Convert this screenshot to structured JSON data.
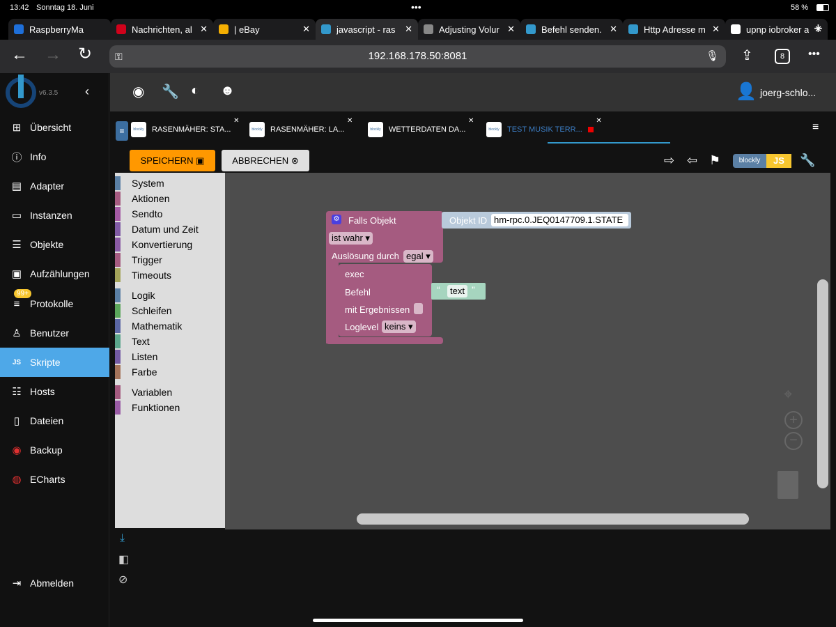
{
  "status": {
    "time": "13:42",
    "date": "Sonntag 18. Juni",
    "battery": "58 %"
  },
  "browser_tabs": [
    {
      "label": "RaspberryMa",
      "color": "#1e6fd9"
    },
    {
      "label": "Nachrichten, al",
      "color": "#d0021b"
    },
    {
      "label": "| eBay",
      "color": "#f5af02"
    },
    {
      "label": "javascript - ras",
      "color": "#3399cc"
    },
    {
      "label": "Adjusting Volur",
      "color": "#888"
    },
    {
      "label": "Befehl senden.",
      "color": "#3399cc"
    },
    {
      "label": "Http Adresse m",
      "color": "#3399cc"
    },
    {
      "label": "upnp iobroker a",
      "color": "#fff"
    }
  ],
  "url": "192.168.178.50:8081",
  "tab_count": "8",
  "app": {
    "version": "v6.3.5",
    "user": "joerg-schlo..."
  },
  "sidebar": [
    {
      "label": "Übersicht",
      "icon": "grid-icon"
    },
    {
      "label": "Info",
      "icon": "info-icon"
    },
    {
      "label": "Adapter",
      "icon": "store-icon"
    },
    {
      "label": "Instanzen",
      "icon": "instances-icon"
    },
    {
      "label": "Objekte",
      "icon": "list-icon"
    },
    {
      "label": "Aufzählungen",
      "icon": "enum-icon"
    },
    {
      "label": "Protokolle",
      "icon": "log-icon",
      "badge": "99+"
    },
    {
      "label": "Benutzer",
      "icon": "user-icon"
    },
    {
      "label": "Skripte",
      "icon": "js-icon"
    },
    {
      "label": "Hosts",
      "icon": "server-icon"
    },
    {
      "label": "Dateien",
      "icon": "files-icon"
    },
    {
      "label": "Backup",
      "icon": "backup-icon"
    },
    {
      "label": "ECharts",
      "icon": "echarts-icon"
    }
  ],
  "logout": "Abmelden",
  "script_tabs": [
    "RASENMÄHER: STA...",
    "RASENMÄHER: LA...",
    "WETTERDATEN DA...",
    "TEST MUSIK TERR..."
  ],
  "toolbar": {
    "save": "SPEICHERN",
    "cancel": "ABBRECHEN",
    "blockly": "blockly",
    "js": "JS"
  },
  "toolbox": [
    {
      "label": "System",
      "color": "#5b80a5"
    },
    {
      "label": "Aktionen",
      "color": "#a55b80"
    },
    {
      "label": "Sendto",
      "color": "#a55ba5"
    },
    {
      "label": "Datum und Zeit",
      "color": "#805ba5"
    },
    {
      "label": "Konvertierung",
      "color": "#8a5ba5"
    },
    {
      "label": "Trigger",
      "color": "#a55b80"
    },
    {
      "label": "Timeouts",
      "color": "#a5a55b"
    },
    {
      "label": "Logik",
      "color": "#5b80a5"
    },
    {
      "label": "Schleifen",
      "color": "#5ba55b"
    },
    {
      "label": "Mathematik",
      "color": "#5b67a5"
    },
    {
      "label": "Text",
      "color": "#5ba58c"
    },
    {
      "label": "Listen",
      "color": "#745ba5"
    },
    {
      "label": "Farbe",
      "color": "#a5745b"
    },
    {
      "label": "Variablen",
      "color": "#a55b80"
    },
    {
      "label": "Funktionen",
      "color": "#995ba5"
    }
  ],
  "block": {
    "title": "Falls Objekt",
    "object_label": "Objekt ID",
    "object_id": "hm-rpc.0.JEQ0147709.1.STATE",
    "condition": "ist wahr",
    "trigger_label": "Auslösung durch",
    "trigger": "egal",
    "exec": "exec",
    "befehl": "Befehl",
    "text": "text",
    "results": "mit Ergebnissen",
    "loglevel_label": "Loglevel",
    "loglevel": "keins"
  }
}
